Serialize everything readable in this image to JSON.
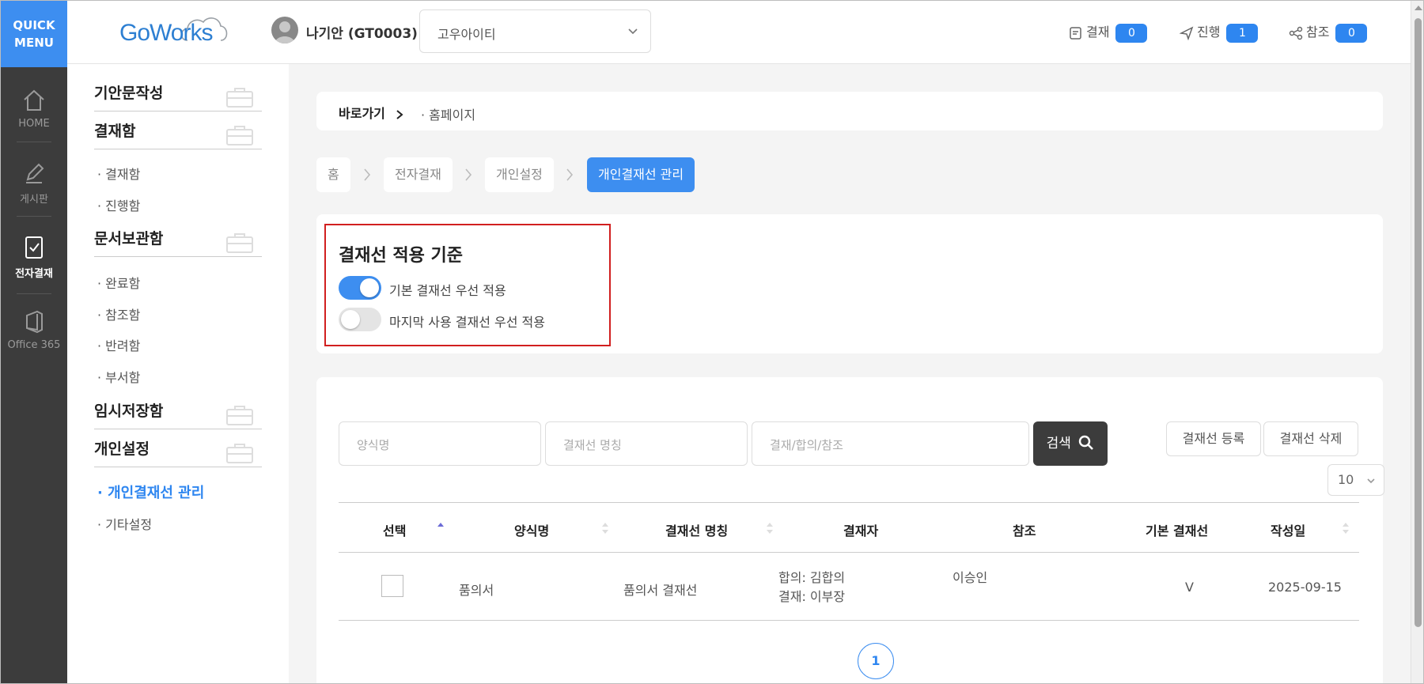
{
  "quick_menu": {
    "line1": "QUICK",
    "line2": "MENU"
  },
  "rail": [
    {
      "label": "HOME",
      "icon": "home-icon"
    },
    {
      "label": "게시판",
      "icon": "pencil-icon"
    },
    {
      "label": "전자결재",
      "icon": "document-check-icon"
    },
    {
      "label": "Office 365",
      "icon": "office-icon"
    }
  ],
  "header": {
    "logo": "GoWorks",
    "user": "나기안 (GT0003)",
    "company": "고우아이티",
    "stats": [
      {
        "label": "결재",
        "count": "0",
        "icon": "approval-icon"
      },
      {
        "label": "진행",
        "count": "1",
        "icon": "send-icon"
      },
      {
        "label": "참조",
        "count": "0",
        "icon": "share-icon"
      }
    ]
  },
  "sidebar": {
    "sections": [
      "기안문작성",
      "결재함",
      "문서보관함",
      "임시저장함",
      "개인설정"
    ],
    "items": {
      "inbox": [
        "결재함",
        "진행함"
      ],
      "archive": [
        "완료함",
        "참조함",
        "반려함",
        "부서함"
      ],
      "personal": [
        "개인결재선 관리",
        "기타설정"
      ]
    }
  },
  "shortcut": {
    "label": "바로가기",
    "home": "· 홈페이지"
  },
  "breadcrumb": [
    "홈",
    "전자결재",
    "개인설정",
    "개인결재선 관리"
  ],
  "standard": {
    "title": "결재선 적용 기준",
    "options": [
      {
        "label": "기본 결재선 우선 적용",
        "on": true
      },
      {
        "label": "마지막 사용 결재선 우선 적용",
        "on": false
      }
    ]
  },
  "search": {
    "form_placeholder": "양식명",
    "line_placeholder": "결재선 명칭",
    "approver_placeholder": "결재/합의/참조",
    "button": "검색",
    "register": "결재선 등록",
    "delete": "결재선 삭제",
    "page_size": "10"
  },
  "table": {
    "headers": [
      "선택",
      "양식명",
      "결재선 명칭",
      "결재자",
      "참조",
      "기본 결재선",
      "작성일"
    ],
    "rows": [
      {
        "form": "품의서",
        "line_name": "품의서 결재선",
        "approver_1": "합의: 김합의",
        "approver_2": "결재: 이부장",
        "ref": "이승인",
        "default": "V",
        "date": "2025-09-15"
      }
    ]
  },
  "pager": {
    "current": "1"
  },
  "colors": {
    "accent": "#3d8ef0",
    "highlight_box": "#d11f1f",
    "rail": "#3c3c3c"
  }
}
